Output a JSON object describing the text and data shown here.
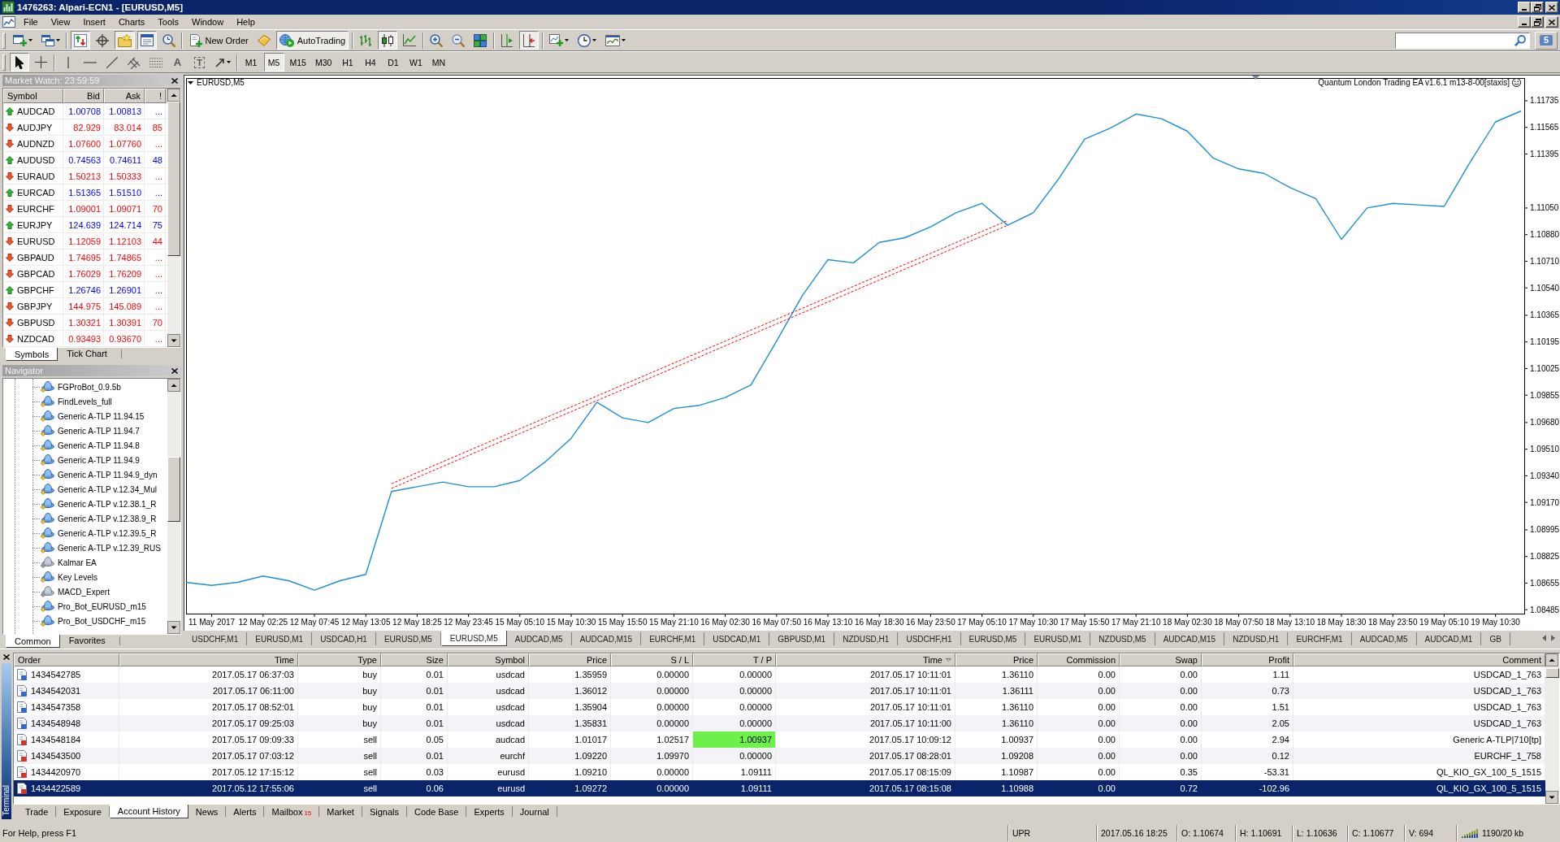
{
  "window": {
    "title": "1476263: Alpari-ECN1 - [EURUSD,M5]"
  },
  "menu": [
    "File",
    "View",
    "Insert",
    "Charts",
    "Tools",
    "Window",
    "Help"
  ],
  "toolbar": [
    [
      {
        "pressed": false
      },
      {
        "pressed": false
      }
    ],
    [
      {
        "pressed": true
      },
      {
        "pressed": false
      },
      {
        "pressed": true
      },
      {
        "pressed": true
      },
      {
        "pressed": false
      }
    ],
    [
      {
        "label": "New Order",
        "pressed": false
      },
      {
        "pressed": false
      },
      {
        "label": "AutoTrading",
        "pressed": true
      }
    ],
    [
      {
        "pressed": false
      },
      {
        "pressed": true
      },
      {
        "pressed": false
      }
    ],
    [
      {
        "pressed": false
      },
      {
        "pressed": false
      },
      {
        "pressed": false
      }
    ],
    [
      {
        "pressed": false
      },
      {
        "pressed": true
      }
    ],
    [
      {
        "pressed": false
      },
      {
        "pressed": false
      },
      {
        "pressed": false
      }
    ]
  ],
  "messages": {
    "count": "5"
  },
  "drawing_tools": [
    [
      {
        "pressed": true
      },
      {
        "pressed": false
      }
    ],
    [
      {
        "pressed": false
      },
      {
        "pressed": false
      },
      {
        "pressed": false
      },
      {
        "pressed": false
      },
      {
        "pressed": false
      },
      {
        "glyph": "A",
        "pressed": false
      },
      {
        "glyph": "T",
        "pressed": false
      },
      {
        "pressed": false
      }
    ]
  ],
  "timeframes": [
    {
      "label": "M1",
      "selected": false
    },
    {
      "label": "M5",
      "selected": true
    },
    {
      "label": "M15",
      "selected": false
    },
    {
      "label": "M30",
      "selected": false
    },
    {
      "label": "H1",
      "selected": false
    },
    {
      "label": "H4",
      "selected": false
    },
    {
      "label": "D1",
      "selected": false
    },
    {
      "label": "W1",
      "selected": false
    },
    {
      "label": "MN",
      "selected": false
    }
  ],
  "market_watch": {
    "title": "Market Watch: 23:59:59",
    "columns": [
      "Symbol",
      "Bid",
      "Ask",
      "!"
    ],
    "rows": [
      {
        "symbol": "AUDCAD",
        "bid": "1.00708",
        "ask": "1.00813",
        "spread": "...",
        "kind": "up"
      },
      {
        "symbol": "AUDJPY",
        "bid": "82.929",
        "ask": "83.014",
        "spread": "85",
        "kind": "down"
      },
      {
        "symbol": "AUDNZD",
        "bid": "1.07600",
        "ask": "1.07760",
        "spread": "...",
        "kind": "down"
      },
      {
        "symbol": "AUDUSD",
        "bid": "0.74563",
        "ask": "0.74611",
        "spread": "48",
        "kind": "up"
      },
      {
        "symbol": "EURAUD",
        "bid": "1.50213",
        "ask": "1.50333",
        "spread": "...",
        "kind": "down"
      },
      {
        "symbol": "EURCAD",
        "bid": "1.51365",
        "ask": "1.51510",
        "spread": "...",
        "kind": "up"
      },
      {
        "symbol": "EURCHF",
        "bid": "1.09001",
        "ask": "1.09071",
        "spread": "70",
        "kind": "down"
      },
      {
        "symbol": "EURJPY",
        "bid": "124.639",
        "ask": "124.714",
        "spread": "75",
        "kind": "up"
      },
      {
        "symbol": "EURUSD",
        "bid": "1.12059",
        "ask": "1.12103",
        "spread": "44",
        "kind": "down"
      },
      {
        "symbol": "GBPAUD",
        "bid": "1.74695",
        "ask": "1.74865",
        "spread": "...",
        "kind": "down"
      },
      {
        "symbol": "GBPCAD",
        "bid": "1.76029",
        "ask": "1.76209",
        "spread": "...",
        "kind": "down"
      },
      {
        "symbol": "GBPCHF",
        "bid": "1.26746",
        "ask": "1.26901",
        "spread": "...",
        "kind": "up"
      },
      {
        "symbol": "GBPJPY",
        "bid": "144.975",
        "ask": "145.089",
        "spread": "...",
        "kind": "down"
      },
      {
        "symbol": "GBPUSD",
        "bid": "1.30321",
        "ask": "1.30391",
        "spread": "70",
        "kind": "down"
      },
      {
        "symbol": "NZDCAD",
        "bid": "0.93493",
        "ask": "0.93670",
        "spread": "...",
        "kind": "down"
      }
    ],
    "tabs": [
      {
        "label": "Symbols",
        "selected": true
      },
      {
        "label": "Tick Chart",
        "selected": false
      }
    ]
  },
  "navigator": {
    "title": "Navigator",
    "items": [
      {
        "label": "FGProBot_0.9.5b",
        "kind": "normal"
      },
      {
        "label": "FindLevels_full",
        "kind": "normal"
      },
      {
        "label": "Generic A-TLP 11.94.15",
        "kind": "normal"
      },
      {
        "label": "Generic A-TLP 11.94.7",
        "kind": "normal"
      },
      {
        "label": "Generic A-TLP 11.94.8",
        "kind": "normal"
      },
      {
        "label": "Generic A-TLP 11.94.9",
        "kind": "normal"
      },
      {
        "label": "Generic A-TLP 11.94.9_dyn",
        "kind": "normal"
      },
      {
        "label": "Generic A-TLP v.12.34_Mul",
        "kind": "normal"
      },
      {
        "label": "Generic A-TLP v.12.38.1_R",
        "kind": "normal"
      },
      {
        "label": "Generic A-TLP v.12.38.9_R",
        "kind": "normal"
      },
      {
        "label": "Generic A-TLP v.12.39.5_R",
        "kind": "normal"
      },
      {
        "label": "Generic A-TLP v.12.39_RUS",
        "kind": "normal"
      },
      {
        "label": "Kalmar EA",
        "kind": "dimmed"
      },
      {
        "label": "Key Levels",
        "kind": "normal"
      },
      {
        "label": "MACD_Expert",
        "kind": "dimmed"
      },
      {
        "label": "Pro_Bot_EURUSD_m15",
        "kind": "normal"
      },
      {
        "label": "Pro_Bot_USDCHF_m15",
        "kind": "normal"
      }
    ],
    "tabs": [
      {
        "label": "Common",
        "selected": true
      },
      {
        "label": "Favorites",
        "selected": false
      }
    ]
  },
  "chart": {
    "title": "EURUSD,M5",
    "expert": "Quantum London Trading EA v1.6.1 m13-8-00[staxis]",
    "chart_data": {
      "type": "line",
      "categories": [
        null,
        "11 May 2017",
        null,
        "12 May 02:25",
        null,
        "12 May 07:45",
        null,
        "12 May 13:05",
        null,
        "12 May 18:25",
        null,
        "12 May 23:45",
        null,
        "15 May 05:10",
        null,
        "15 May 10:30",
        null,
        "15 May 15:50",
        null,
        "15 May 21:10",
        null,
        "16 May 02:30",
        null,
        "16 May 07:50",
        null,
        "16 May 13:10",
        null,
        "16 May 18:30",
        null,
        "16 May 23:50",
        null,
        "17 May 05:10",
        null,
        "17 May 10:30",
        null,
        "17 May 15:50",
        null,
        "17 May 21:10",
        null,
        "18 May 02:30",
        null,
        "18 May 07:50",
        null,
        "18 May 13:10",
        null,
        "18 May 18:30",
        null,
        "18 May 23:50",
        null,
        "19 May 05:10",
        null,
        "19 May 10:30",
        null
      ],
      "series": [
        {
          "color": "#1e8fd0",
          "values": [
            1.0866,
            1.0864,
            1.0866,
            1.087,
            1.0867,
            1.0861,
            1.0867,
            1.0871,
            1.0924,
            1.0927,
            1.093,
            1.0927,
            1.0927,
            1.0931,
            1.0943,
            1.0958,
            1.0981,
            1.0971,
            1.0968,
            1.0977,
            1.0979,
            1.0984,
            1.0992,
            1.102,
            1.1049,
            1.1072,
            1.107,
            1.1083,
            1.1086,
            1.1093,
            1.1102,
            1.1108,
            1.1094,
            1.1102,
            1.1124,
            1.1149,
            1.1156,
            1.1165,
            1.1162,
            1.1154,
            1.1137,
            1.113,
            1.1127,
            1.1118,
            1.1111,
            1.1085,
            1.1105,
            1.1108,
            1.1107,
            1.1106,
            1.1134,
            1.116,
            1.1167
          ]
        },
        {
          "color": "#ff0000",
          "line_style": "dashed",
          "values": [
            null,
            null,
            null,
            null,
            null,
            null,
            null,
            null,
            1.0929,
            1.0936,
            1.0943,
            1.095,
            1.0957,
            1.0964,
            1.0971,
            1.0978,
            1.0985,
            1.0992,
            1.0999,
            1.1006,
            1.1013,
            1.102,
            1.1027,
            1.1034,
            1.1041,
            1.1048,
            1.1055,
            1.1062,
            1.1069,
            1.1076,
            1.1083,
            1.109,
            1.1097,
            null,
            null,
            null,
            null,
            null,
            null,
            null,
            null,
            null,
            null,
            null,
            null,
            null,
            null,
            null,
            null,
            null,
            null,
            null,
            null
          ]
        },
        {
          "color": "#ff0000",
          "line_style": "dashed",
          "values": [
            null,
            null,
            null,
            null,
            null,
            null,
            null,
            null,
            1.0926,
            1.0933,
            1.094,
            1.0947,
            1.0954,
            1.0961,
            1.0968,
            1.0975,
            1.0982,
            1.0989,
            1.0996,
            1.1003,
            1.101,
            1.1017,
            1.1024,
            1.1031,
            1.1038,
            1.1045,
            1.1052,
            1.1059,
            1.1066,
            1.1073,
            1.108,
            1.1087,
            1.1094,
            null,
            null,
            null,
            null,
            null,
            null,
            null,
            null,
            null,
            null,
            null,
            null,
            null,
            null,
            null,
            null,
            null,
            null,
            null,
            null
          ]
        }
      ],
      "ylim": [
        1.0846,
        1.1188
      ],
      "yticks": [
        {
          "value": 1.11735,
          "label": "1.11735"
        },
        {
          "value": 1.11565,
          "label": "1.11565"
        },
        {
          "value": 1.11395,
          "label": "1.11395"
        },
        {
          "value": 1.1105,
          "label": "1.11050"
        },
        {
          "value": 1.1088,
          "label": "1.10880"
        },
        {
          "value": 1.1071,
          "label": "1.10710"
        },
        {
          "value": 1.1054,
          "label": "1.10540"
        },
        {
          "value": 1.10365,
          "label": "1.10365"
        },
        {
          "value": 1.10195,
          "label": "1.10195"
        },
        {
          "value": 1.10025,
          "label": "1.10025"
        },
        {
          "value": 1.09855,
          "label": "1.09855"
        },
        {
          "value": 1.0968,
          "label": "1.09680"
        },
        {
          "value": 1.0951,
          "label": "1.09510"
        },
        {
          "value": 1.0934,
          "label": "1.09340"
        },
        {
          "value": 1.0917,
          "label": "1.09170"
        },
        {
          "value": 1.08995,
          "label": "1.08995"
        },
        {
          "value": 1.08825,
          "label": "1.08825"
        },
        {
          "value": 1.08655,
          "label": "1.08655"
        },
        {
          "value": 1.08485,
          "label": "1.08485"
        }
      ]
    }
  },
  "chart_tabs": [
    {
      "label": "USDCHF,M1",
      "selected": false
    },
    {
      "label": "EURUSD,M1",
      "selected": false
    },
    {
      "label": "USDCAD,H1",
      "selected": false
    },
    {
      "label": "EURUSD,M5",
      "selected": false
    },
    {
      "label": "EURUSD,M5",
      "selected": true
    },
    {
      "label": "AUDCAD,M5",
      "selected": false
    },
    {
      "label": "AUDCAD,M15",
      "selected": false
    },
    {
      "label": "EURCHF,M1",
      "selected": false
    },
    {
      "label": "USDCAD,M1",
      "selected": false
    },
    {
      "label": "GBPUSD,M1",
      "selected": false
    },
    {
      "label": "NZDUSD,H1",
      "selected": false
    },
    {
      "label": "USDCHF,H1",
      "selected": false
    },
    {
      "label": "EURUSD,M5",
      "selected": false
    },
    {
      "label": "EURUSD,M1",
      "selected": false
    },
    {
      "label": "NZDUSD,M5",
      "selected": false
    },
    {
      "label": "AUDCAD,M15",
      "selected": false
    },
    {
      "label": "NZDUSD,H1",
      "selected": false
    },
    {
      "label": "EURCHF,M1",
      "selected": false
    },
    {
      "label": "AUDCAD,M5",
      "selected": false
    },
    {
      "label": "AUDCAD,M1",
      "selected": false
    },
    {
      "label": "GB",
      "selected": false
    }
  ],
  "terminal": {
    "title": "Terminal",
    "columns": [
      {
        "label": "Order",
        "sorted": false
      },
      {
        "label": "Time",
        "sorted": false
      },
      {
        "label": "Type",
        "sorted": false
      },
      {
        "label": "Size",
        "sorted": false
      },
      {
        "label": "Symbol",
        "sorted": false
      },
      {
        "label": "Price",
        "sorted": false
      },
      {
        "label": "S / L",
        "sorted": false
      },
      {
        "label": "T / P",
        "sorted": false
      },
      {
        "label": "Time",
        "sorted": true
      },
      {
        "label": "Price",
        "sorted": false
      },
      {
        "label": "Commission",
        "sorted": false
      },
      {
        "label": "Swap",
        "sorted": false
      },
      {
        "label": "Profit",
        "sorted": false
      },
      {
        "label": "Comment",
        "sorted": false
      }
    ],
    "rows": [
      {
        "order": "1434542785",
        "open_time": "2017.05.17 06:37:03",
        "type": "buy",
        "size": "0.01",
        "symbol": "usdcad",
        "open_price": "1.35959",
        "sl": "0.00000",
        "tp": "0.00000",
        "close_time": "2017.05.17 10:11:01",
        "close_price": "1.36110",
        "commission": "0.00",
        "swap": "0.00",
        "profit": "1.11",
        "comment": "USDCAD_1_763",
        "kind": "buy",
        "tp_hit": false,
        "selected": false
      },
      {
        "order": "1434542031",
        "open_time": "2017.05.17 06:11:00",
        "type": "buy",
        "size": "0.01",
        "symbol": "usdcad",
        "open_price": "1.36012",
        "sl": "0.00000",
        "tp": "0.00000",
        "close_time": "2017.05.17 10:11:01",
        "close_price": "1.36111",
        "commission": "0.00",
        "swap": "0.00",
        "profit": "0.73",
        "comment": "USDCAD_1_763",
        "kind": "buy",
        "tp_hit": false,
        "selected": false
      },
      {
        "order": "1434547358",
        "open_time": "2017.05.17 08:52:01",
        "type": "buy",
        "size": "0.01",
        "symbol": "usdcad",
        "open_price": "1.35904",
        "sl": "0.00000",
        "tp": "0.00000",
        "close_time": "2017.05.17 10:11:01",
        "close_price": "1.36110",
        "commission": "0.00",
        "swap": "0.00",
        "profit": "1.51",
        "comment": "USDCAD_1_763",
        "kind": "buy",
        "tp_hit": false,
        "selected": false
      },
      {
        "order": "1434548948",
        "open_time": "2017.05.17 09:25:03",
        "type": "buy",
        "size": "0.01",
        "symbol": "usdcad",
        "open_price": "1.35831",
        "sl": "0.00000",
        "tp": "0.00000",
        "close_time": "2017.05.17 10:11:00",
        "close_price": "1.36110",
        "commission": "0.00",
        "swap": "0.00",
        "profit": "2.05",
        "comment": "USDCAD_1_763",
        "kind": "buy",
        "tp_hit": false,
        "selected": false
      },
      {
        "order": "1434548184",
        "open_time": "2017.05.17 09:09:33",
        "type": "sell",
        "size": "0.05",
        "symbol": "audcad",
        "open_price": "1.01017",
        "sl": "1.02517",
        "tp": "1.00937",
        "close_time": "2017.05.17 10:09:12",
        "close_price": "1.00937",
        "commission": "0.00",
        "swap": "0.00",
        "profit": "2.94",
        "comment": "Generic A-TLP|710[tp]",
        "kind": "sell",
        "tp_hit": true,
        "selected": false
      },
      {
        "order": "1434543500",
        "open_time": "2017.05.17 07:03:12",
        "type": "sell",
        "size": "0.01",
        "symbol": "eurchf",
        "open_price": "1.09220",
        "sl": "1.09970",
        "tp": "0.00000",
        "close_time": "2017.05.17 08:28:01",
        "close_price": "1.09208",
        "commission": "0.00",
        "swap": "0.00",
        "profit": "0.12",
        "comment": "EURCHF_1_758",
        "kind": "sell",
        "tp_hit": false,
        "selected": false
      },
      {
        "order": "1434420970",
        "open_time": "2017.05.12 17:15:12",
        "type": "sell",
        "size": "0.03",
        "symbol": "eurusd",
        "open_price": "1.09210",
        "sl": "0.00000",
        "tp": "1.09111",
        "close_time": "2017.05.17 08:15:09",
        "close_price": "1.10987",
        "commission": "0.00",
        "swap": "0.35",
        "profit": "-53.31",
        "comment": "QL_KIO_GX_100_5_1515",
        "kind": "sell",
        "tp_hit": false,
        "selected": false
      },
      {
        "order": "1434422589",
        "open_time": "2017.05.12 17:55:06",
        "type": "sell",
        "size": "0.06",
        "symbol": "eurusd",
        "open_price": "1.09272",
        "sl": "0.00000",
        "tp": "1.09111",
        "close_time": "2017.05.17 08:15:08",
        "close_price": "1.10988",
        "commission": "0.00",
        "swap": "0.72",
        "profit": "-102.96",
        "comment": "QL_KIO_GX_100_5_1515",
        "kind": "sell",
        "tp_hit": false,
        "selected": true
      }
    ],
    "tabs": [
      {
        "label": "Trade",
        "selected": false
      },
      {
        "label": "Exposure",
        "selected": false
      },
      {
        "label": "Account History",
        "selected": true
      },
      {
        "label": "News",
        "selected": false
      },
      {
        "label": "Alerts",
        "selected": false
      },
      {
        "label": "Mailbox",
        "badge": "15",
        "selected": false
      },
      {
        "label": "Market",
        "selected": false
      },
      {
        "label": "Signals",
        "selected": false
      },
      {
        "label": "Code Base",
        "selected": false
      },
      {
        "label": "Experts",
        "selected": false
      },
      {
        "label": "Journal",
        "selected": false
      }
    ]
  },
  "status_bar": {
    "help": "For Help, press F1",
    "cells": [
      "UPR",
      "2017.05.16 18:25",
      "O: 1.10674",
      "H: 1.10691",
      "L: 1.10636",
      "C: 1.10677",
      "V: 694"
    ],
    "traffic": "1190/20 kb"
  }
}
